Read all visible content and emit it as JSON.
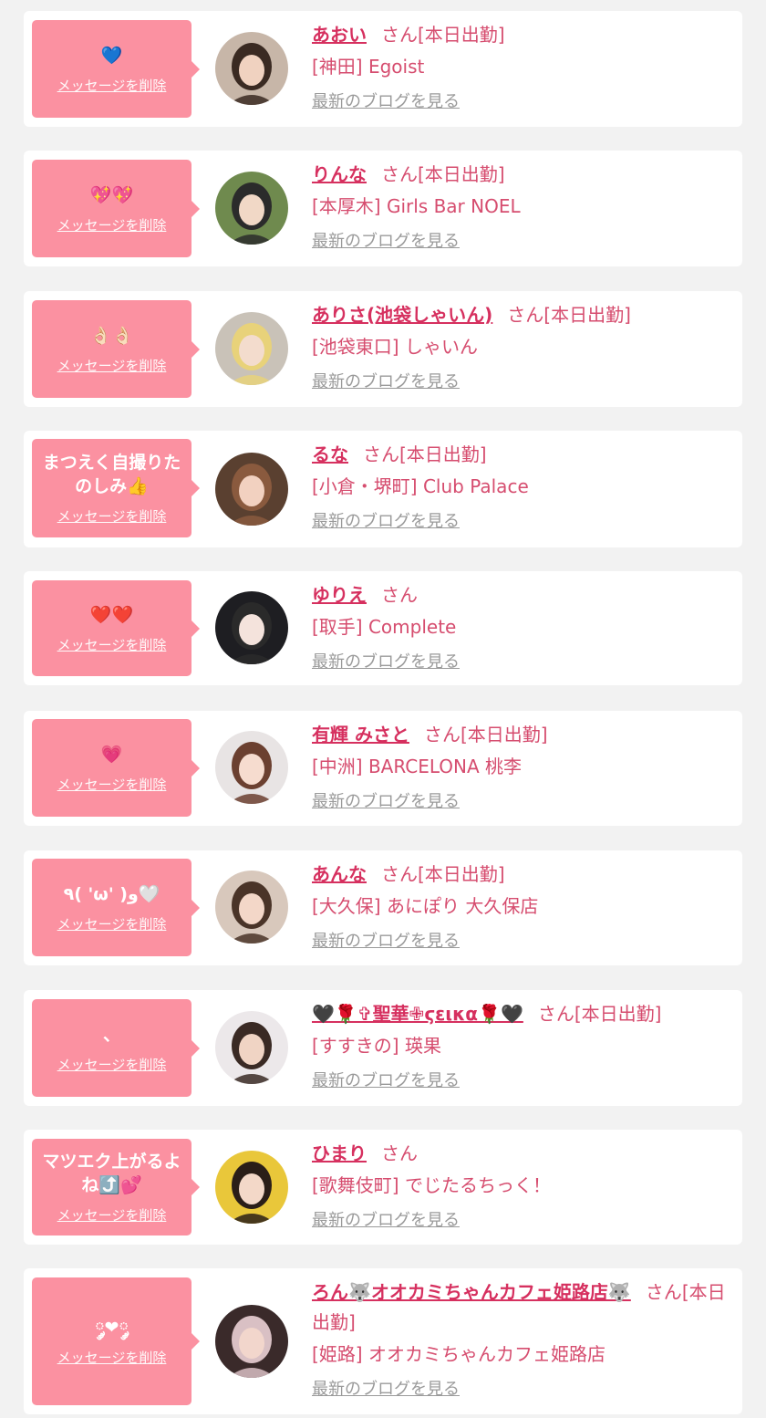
{
  "common": {
    "delete_label": "メッセージを削除",
    "blog_label": "最新のブログを見る",
    "san": "さん"
  },
  "colors": {
    "page_bg": "#f2f2f2",
    "bubble": "#fb91a1",
    "name": "#d6305f",
    "text": "#d64d6f",
    "link_gray": "#9a9a9a"
  },
  "items": [
    {
      "message": "💙",
      "name": "あおい",
      "status": "[本日出勤]",
      "shop": "[神田] Egoist"
    },
    {
      "message": "💖💖",
      "name": "りんな",
      "status": "[本日出勤]",
      "shop": "[本厚木] Girls Bar NOEL"
    },
    {
      "message": "👌🏻👌🏻",
      "name": "ありさ(池袋しゃいん)",
      "status": "[本日出勤]",
      "shop": "[池袋東口] しゃいん"
    },
    {
      "message": "まつえく自撮りたのしみ👍",
      "name": "るな",
      "status": "[本日出勤]",
      "shop": "[小倉・堺町] Club Palace"
    },
    {
      "message": "❤️❤️",
      "name": "ゆりえ",
      "status": "",
      "shop": "[取手] Complete"
    },
    {
      "message": "💗",
      "name": "有輝 みさと",
      "status": "[本日出勤]",
      "shop": "[中洲] BARCELONA 桃李"
    },
    {
      "message": "٩( 'ω' )و🤍",
      "name": "あんな",
      "status": "[本日出勤]",
      "shop": "[大久保] あにぽり 大久保店"
    },
    {
      "message": "、",
      "name": "🖤🌹✞聖華✙ϛεικα🌹🖤",
      "status": "[本日出勤]",
      "shop": "[すすきの] 瑛果"
    },
    {
      "message": "マツエク上がるよね⤴️💕",
      "name": "ひまり",
      "status": "",
      "shop": "[歌舞伎町] でじたるちっく！"
    },
    {
      "message": "༘❤︎༘",
      "name": "ろん🐺オオカミちゃんカフェ姫路店🐺",
      "status": "[本日出勤]",
      "shop": "[姫路] オオカミちゃんカフェ姫路店"
    }
  ]
}
